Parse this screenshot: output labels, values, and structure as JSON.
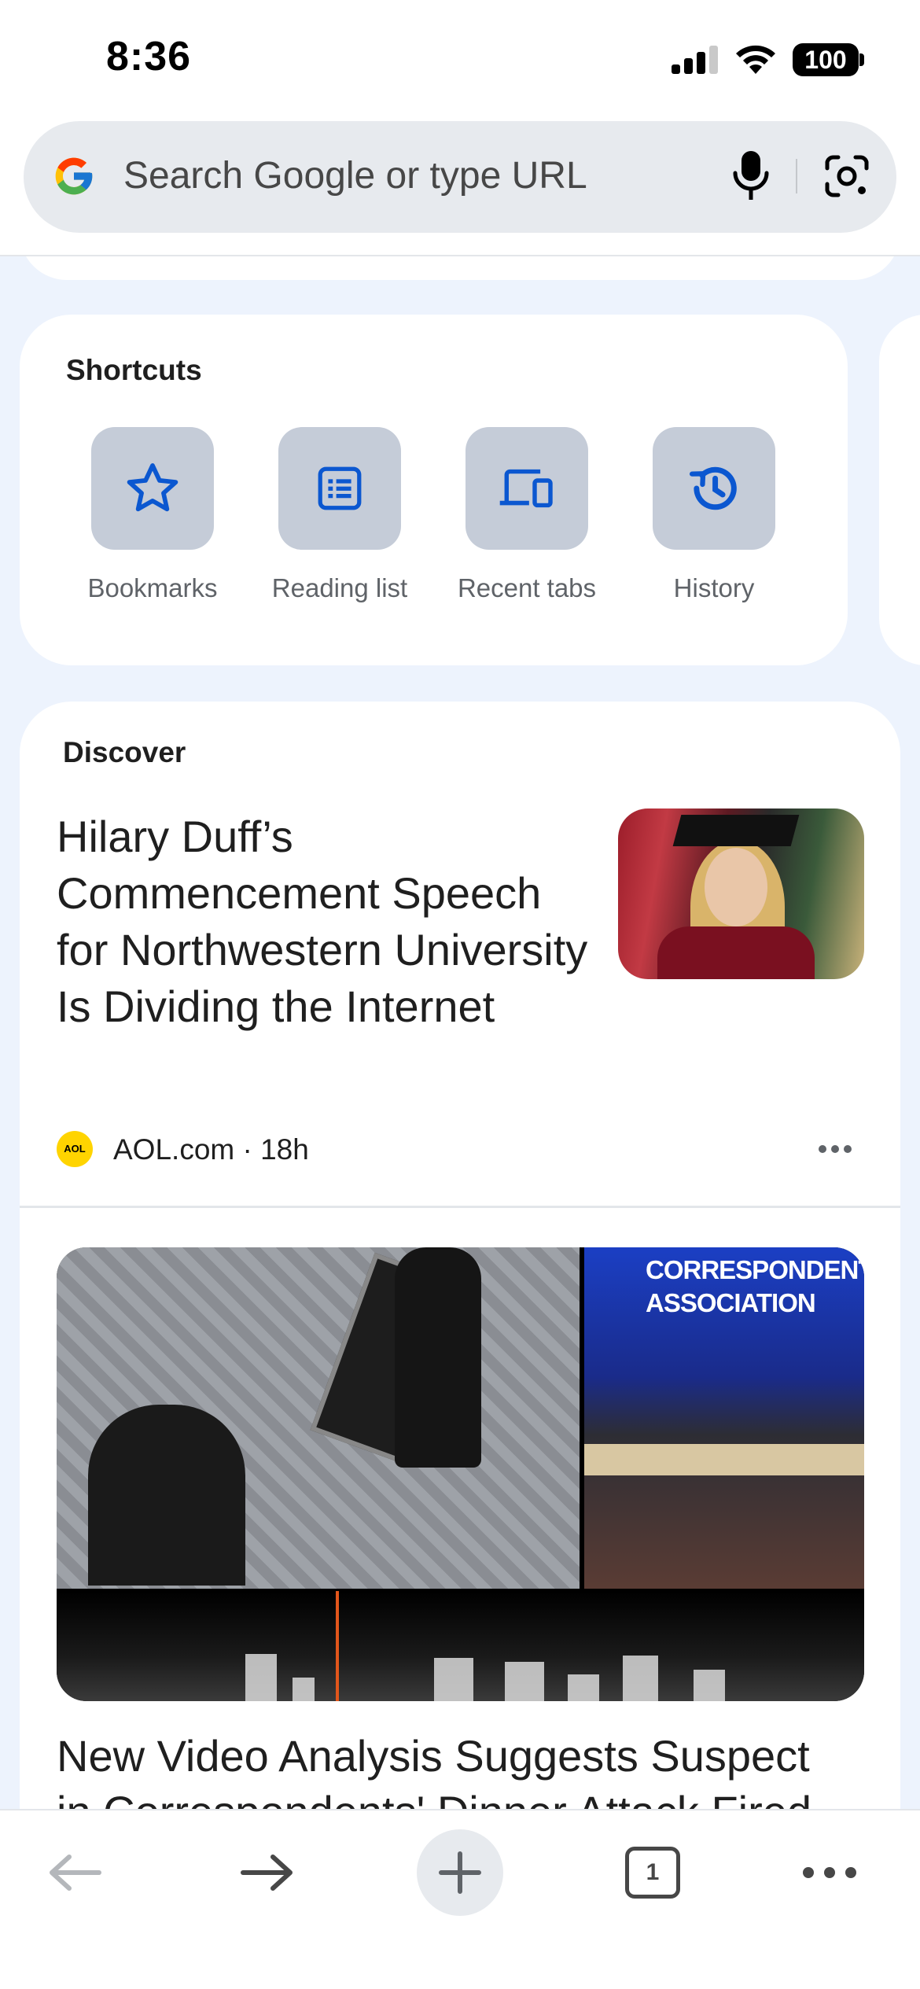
{
  "status_bar": {
    "time": "8:36",
    "battery": "100"
  },
  "search": {
    "placeholder": "Search Google or type URL"
  },
  "shortcuts": {
    "title": "Shortcuts",
    "items": [
      {
        "label": "Bookmarks",
        "icon": "star-icon"
      },
      {
        "label": "Reading list",
        "icon": "reading-list-icon"
      },
      {
        "label": "Recent tabs",
        "icon": "devices-icon"
      },
      {
        "label": "History",
        "icon": "history-icon"
      }
    ]
  },
  "discover": {
    "title": "Discover",
    "articles": [
      {
        "headline": "Hilary Duff’s Commencement Speech for Northwestern University Is Dividing the Internet",
        "source_badge": "AOL",
        "source": "AOL.com · 18h",
        "image": "graduate-at-podium"
      },
      {
        "headline_line1": "New Video Analysis Suggests Suspect",
        "headline_line2": "in Correspondents' Dinner Attack Fired",
        "image_sign": "CORRESPONDENTS' ASSOCIATION"
      }
    ]
  },
  "toolbar": {
    "tab_count": "1",
    "icons": [
      "back-arrow-icon",
      "forward-arrow-icon",
      "plus-icon",
      "tab-switcher-icon",
      "more-menu-icon"
    ]
  },
  "colors": {
    "accent": "#0b57d0",
    "tile": "#c5ccd8",
    "background": "#edf3fd"
  }
}
